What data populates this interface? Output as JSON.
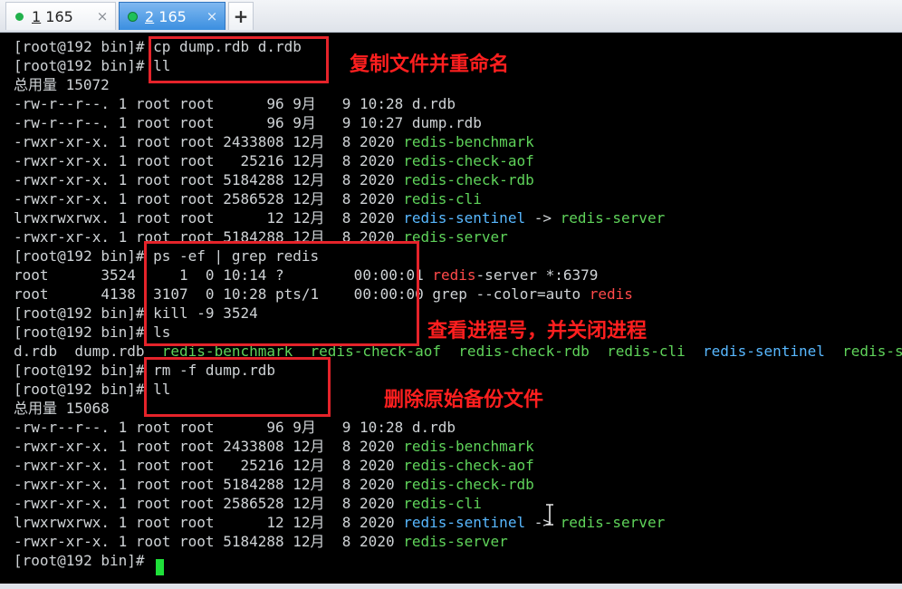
{
  "tabs": [
    {
      "index": "1",
      "title": "165",
      "close": "×",
      "active": false
    },
    {
      "index": "2",
      "title": "165",
      "close": "×",
      "active": true
    }
  ],
  "new_tab_label": "+",
  "terminal": {
    "lines": [
      [
        {
          "t": "[root@192 bin]# cp dump.rdb d.rdb"
        }
      ],
      [
        {
          "t": "[root@192 bin]# ll"
        }
      ],
      [
        {
          "t": "总用量 15072"
        }
      ],
      [
        {
          "t": "-rw-r--r--. 1 root root      96 9月   9 10:28 d.rdb"
        }
      ],
      [
        {
          "t": "-rw-r--r--. 1 root root      96 9月   9 10:27 dump.rdb"
        }
      ],
      [
        {
          "t": "-rwxr-xr-x. 1 root root 2433808 12月  8 2020 "
        },
        {
          "t": "redis-benchmark",
          "c": "g"
        }
      ],
      [
        {
          "t": "-rwxr-xr-x. 1 root root   25216 12月  8 2020 "
        },
        {
          "t": "redis-check-aof",
          "c": "g"
        }
      ],
      [
        {
          "t": "-rwxr-xr-x. 1 root root 5184288 12月  8 2020 "
        },
        {
          "t": "redis-check-rdb",
          "c": "g"
        }
      ],
      [
        {
          "t": "-rwxr-xr-x. 1 root root 2586528 12月  8 2020 "
        },
        {
          "t": "redis-cli",
          "c": "g"
        }
      ],
      [
        {
          "t": "lrwxrwxrwx. 1 root root      12 12月  8 2020 "
        },
        {
          "t": "redis-sentinel",
          "c": "b"
        },
        {
          "t": " -> "
        },
        {
          "t": "redis-server",
          "c": "g"
        }
      ],
      [
        {
          "t": "-rwxr-xr-x. 1 root root 5184288 12月  8 2020 "
        },
        {
          "t": "redis-server",
          "c": "g"
        }
      ],
      [
        {
          "t": "[root@192 bin]# ps -ef | grep redis"
        }
      ],
      [
        {
          "t": "root      3524     1  0 10:14 ?        00:00:01 "
        },
        {
          "t": "redis",
          "c": "r"
        },
        {
          "t": "-server *:6379"
        }
      ],
      [
        {
          "t": "root      4138  3107  0 10:28 pts/1    00:00:00 grep --color=auto "
        },
        {
          "t": "redis",
          "c": "r"
        }
      ],
      [
        {
          "t": "[root@192 bin]# kill -9 3524"
        }
      ],
      [
        {
          "t": "[root@192 bin]# ls"
        }
      ],
      [
        {
          "t": "d.rdb  dump.rdb  "
        },
        {
          "t": "redis-benchmark",
          "c": "g"
        },
        {
          "t": "  "
        },
        {
          "t": "redis-check-aof",
          "c": "g"
        },
        {
          "t": "  "
        },
        {
          "t": "redis-check-rdb",
          "c": "g"
        },
        {
          "t": "  "
        },
        {
          "t": "redis-cli",
          "c": "g"
        },
        {
          "t": "  "
        },
        {
          "t": "redis-sentinel",
          "c": "b"
        },
        {
          "t": "  "
        },
        {
          "t": "redis-server",
          "c": "g"
        }
      ],
      [
        {
          "t": "[root@192 bin]# rm -f dump.rdb"
        }
      ],
      [
        {
          "t": "[root@192 bin]# ll"
        }
      ],
      [
        {
          "t": "总用量 15068"
        }
      ],
      [
        {
          "t": "-rw-r--r--. 1 root root      96 9月   9 10:28 d.rdb"
        }
      ],
      [
        {
          "t": "-rwxr-xr-x. 1 root root 2433808 12月  8 2020 "
        },
        {
          "t": "redis-benchmark",
          "c": "g"
        }
      ],
      [
        {
          "t": "-rwxr-xr-x. 1 root root   25216 12月  8 2020 "
        },
        {
          "t": "redis-check-aof",
          "c": "g"
        }
      ],
      [
        {
          "t": "-rwxr-xr-x. 1 root root 5184288 12月  8 2020 "
        },
        {
          "t": "redis-check-rdb",
          "c": "g"
        }
      ],
      [
        {
          "t": "-rwxr-xr-x. 1 root root 2586528 12月  8 2020 "
        },
        {
          "t": "redis-cli",
          "c": "g"
        }
      ],
      [
        {
          "t": "lrwxrwxrwx. 1 root root      12 12月  8 2020 "
        },
        {
          "t": "redis-sentinel",
          "c": "b"
        },
        {
          "t": " -> "
        },
        {
          "t": "redis-server",
          "c": "g"
        }
      ],
      [
        {
          "t": "-rwxr-xr-x. 1 root root 5184288 12月  8 2020 "
        },
        {
          "t": "redis-server",
          "c": "g"
        }
      ],
      [
        {
          "t": "[root@192 bin]# "
        }
      ]
    ]
  },
  "annotations": {
    "copy_rename": "复制文件并重命名",
    "check_kill": "查看进程号，并关闭进程",
    "delete_backup": "删除原始备份文件"
  },
  "colors": {
    "file_green": "#5fd35a",
    "symlink_blue": "#58b8ff",
    "grep_match_red": "#ff4a4a",
    "annotation_red": "#ff1f1f",
    "cursor_green": "#1fe03a"
  },
  "icons": {
    "status_dot": "green-dot-icon",
    "close": "close-icon",
    "new_tab": "plus-icon",
    "mouse": "text-cursor-icon"
  }
}
